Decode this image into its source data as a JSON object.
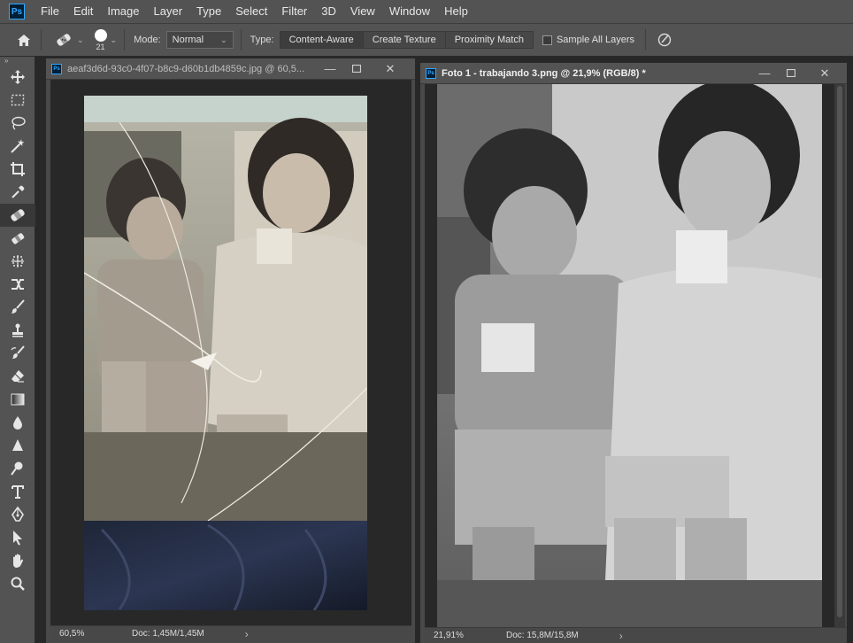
{
  "app": {
    "logo": "Ps"
  },
  "menu": [
    "File",
    "Edit",
    "Image",
    "Layer",
    "Type",
    "Select",
    "Filter",
    "3D",
    "View",
    "Window",
    "Help"
  ],
  "options": {
    "brush_size": "21",
    "mode_label": "Mode:",
    "mode_value": "Normal",
    "type_label": "Type:",
    "type_options": [
      "Content-Aware",
      "Create Texture",
      "Proximity Match"
    ],
    "sample_all_layers": "Sample All Layers"
  },
  "tools": [
    "move-icon",
    "marquee-icon",
    "lasso-icon",
    "magic-wand-icon",
    "crop-icon",
    "eyedropper-icon",
    "spot-healing-icon",
    "patch-icon",
    "frame-icon",
    "content-aware-move-icon",
    "brush-icon",
    "clone-stamp-icon",
    "history-brush-icon",
    "eraser-icon",
    "gradient-icon",
    "blur-icon",
    "sharpen-icon",
    "dodge-icon",
    "type-icon",
    "pen-icon",
    "path-selection-icon",
    "hand-icon",
    "zoom-icon"
  ],
  "doc1": {
    "title": "aeaf3d6d-93c0-4f07-b8c9-d60b1db4859c.jpg @ 60,5...",
    "zoom": "60,5%",
    "info": "Doc: 1,45M/1,45M"
  },
  "doc2": {
    "title": "Foto 1 - trabajando 3.png @ 21,9% (RGB/8) *",
    "zoom": "21,91%",
    "info": "Doc: 15,8M/15,8M"
  },
  "colors": {
    "menubar": "#535353",
    "canvas": "#282828",
    "accent": "#31a8ff"
  }
}
